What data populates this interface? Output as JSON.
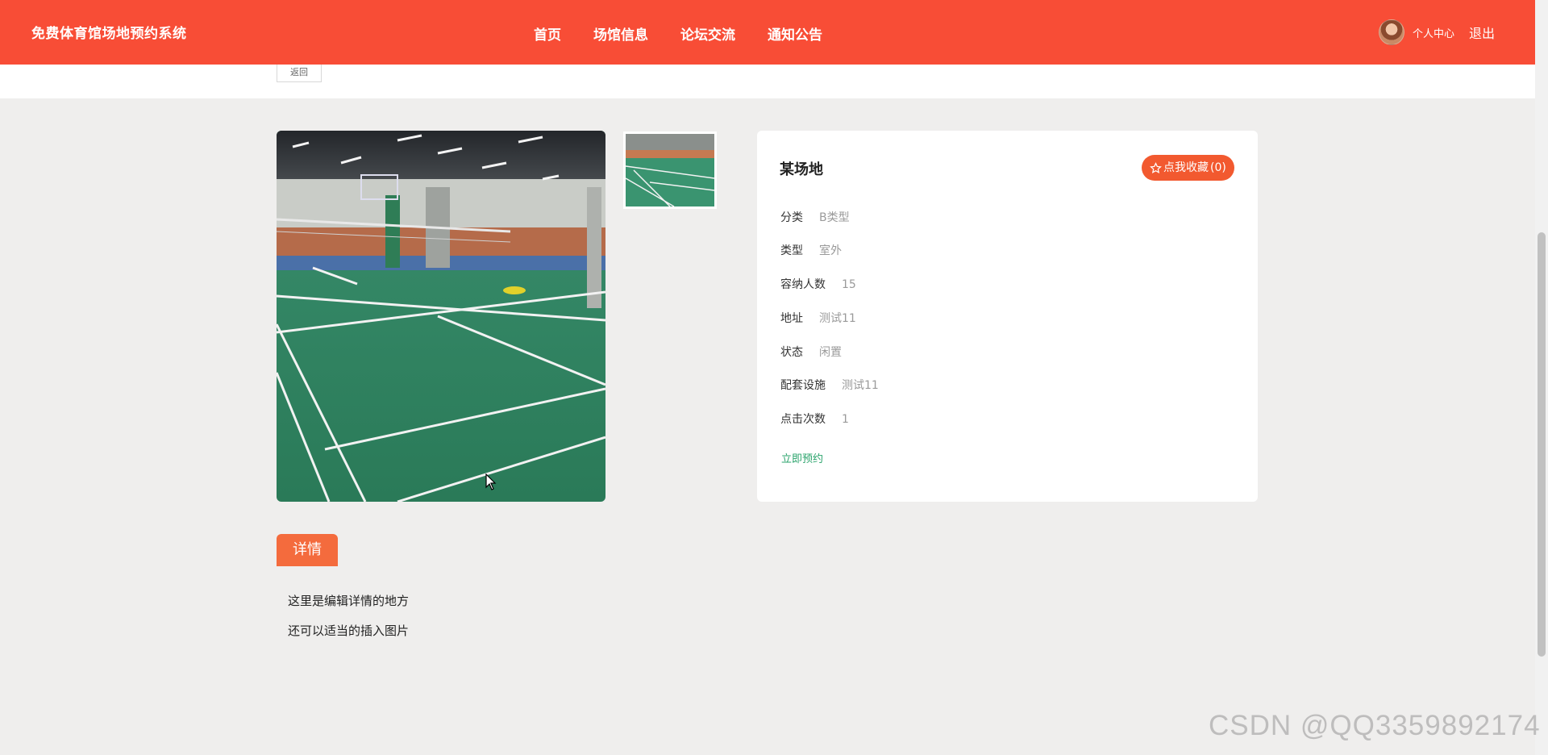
{
  "header": {
    "site_title": "免费体育馆场地预约系统",
    "nav": [
      "首页",
      "场馆信息",
      "论坛交流",
      "通知公告"
    ],
    "profile_label": "个人中心",
    "logout_label": "退出",
    "bg_color": "#f84d36"
  },
  "toolbar": {
    "back_label": "返回"
  },
  "venue": {
    "name": "某场地",
    "favorite_label": "点我收藏",
    "favorite_count": "(0)",
    "fields": [
      {
        "label": "分类",
        "value": "B类型"
      },
      {
        "label": "类型",
        "value": "室外"
      },
      {
        "label": "容纳人数",
        "value": "15"
      },
      {
        "label": "地址",
        "value": "测试11"
      },
      {
        "label": "状态",
        "value": "闲置"
      },
      {
        "label": "配套设施",
        "value": "测试11"
      },
      {
        "label": "点击次数",
        "value": "1"
      }
    ],
    "book_label": "立即预约"
  },
  "details": {
    "tab_label": "详情",
    "lines": [
      "这里是编辑详情的地方",
      "还可以适当的插入图片"
    ]
  },
  "watermark": "CSDN @QQ3359892174",
  "icons": {
    "favorite": "star-icon",
    "profile": "avatar",
    "photo": "badminton-court-photo"
  },
  "colors": {
    "accent": "#f2592f",
    "book_link": "#2aa36b",
    "tab": "#f46b3d"
  }
}
